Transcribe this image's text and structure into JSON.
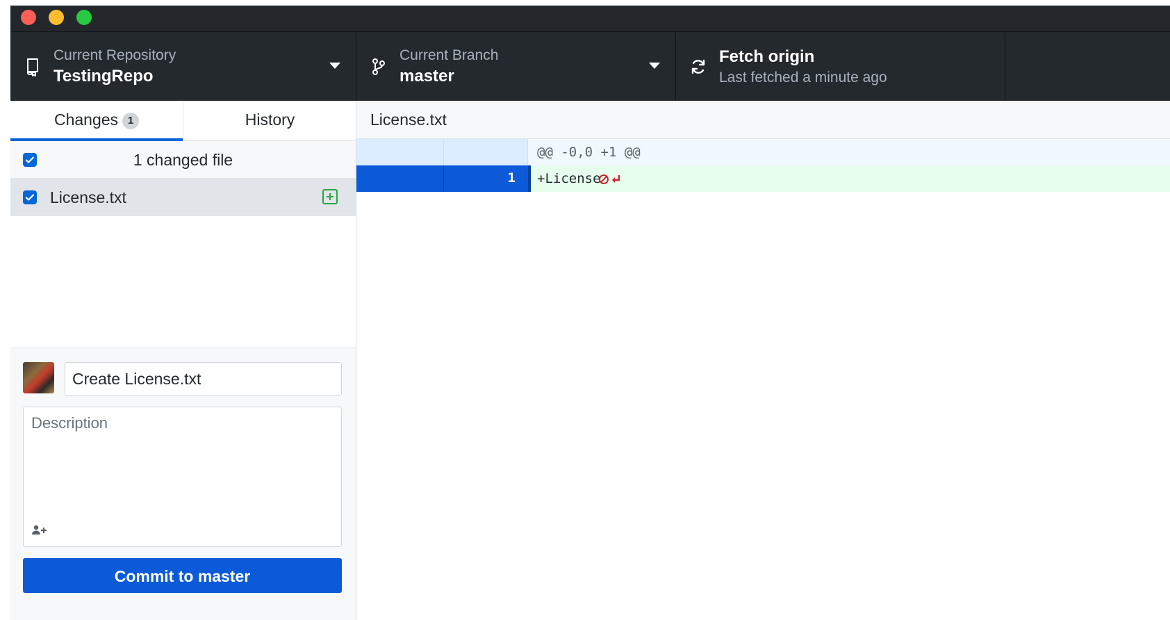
{
  "window": {
    "controls": [
      "close",
      "minimize",
      "zoom"
    ]
  },
  "toolbar": {
    "repository": {
      "label": "Current Repository",
      "value": "TestingRepo",
      "icon": "repo-icon"
    },
    "branch": {
      "label": "Current Branch",
      "value": "master",
      "icon": "branch-icon"
    },
    "fetch": {
      "label": "Fetch origin",
      "value": "Last fetched a minute ago",
      "icon": "sync-icon"
    }
  },
  "sidebar": {
    "tabs": [
      {
        "label": "Changes",
        "count": "1",
        "selected": true
      },
      {
        "label": "History",
        "selected": false
      }
    ],
    "changes_header": {
      "label": "1 changed file",
      "checked": true
    },
    "files": [
      {
        "name": "License.txt",
        "checked": true,
        "status": "added"
      }
    ]
  },
  "commit": {
    "summary_value": "Create License.txt",
    "description_placeholder": "Description",
    "button_label": "Commit to master",
    "coauthor_icon": "add-coauthor-icon",
    "avatar_icon": "user-avatar"
  },
  "diff": {
    "file_path": "License.txt",
    "hunk_header": "@@ -0,0 +1 @@",
    "lines": [
      {
        "new_line_no": "1",
        "content": "+License",
        "type": "added",
        "no_newline_marker": true
      }
    ]
  },
  "colors": {
    "toolbar_bg": "#24292e",
    "accent_blue": "#0366d6",
    "commit_button": "#0c5ad8",
    "added_line_bg": "#e6ffed",
    "hunk_bg": "#f1f8ff",
    "added_icon": "#28a745",
    "no_newline_marker": "#cb2431"
  }
}
